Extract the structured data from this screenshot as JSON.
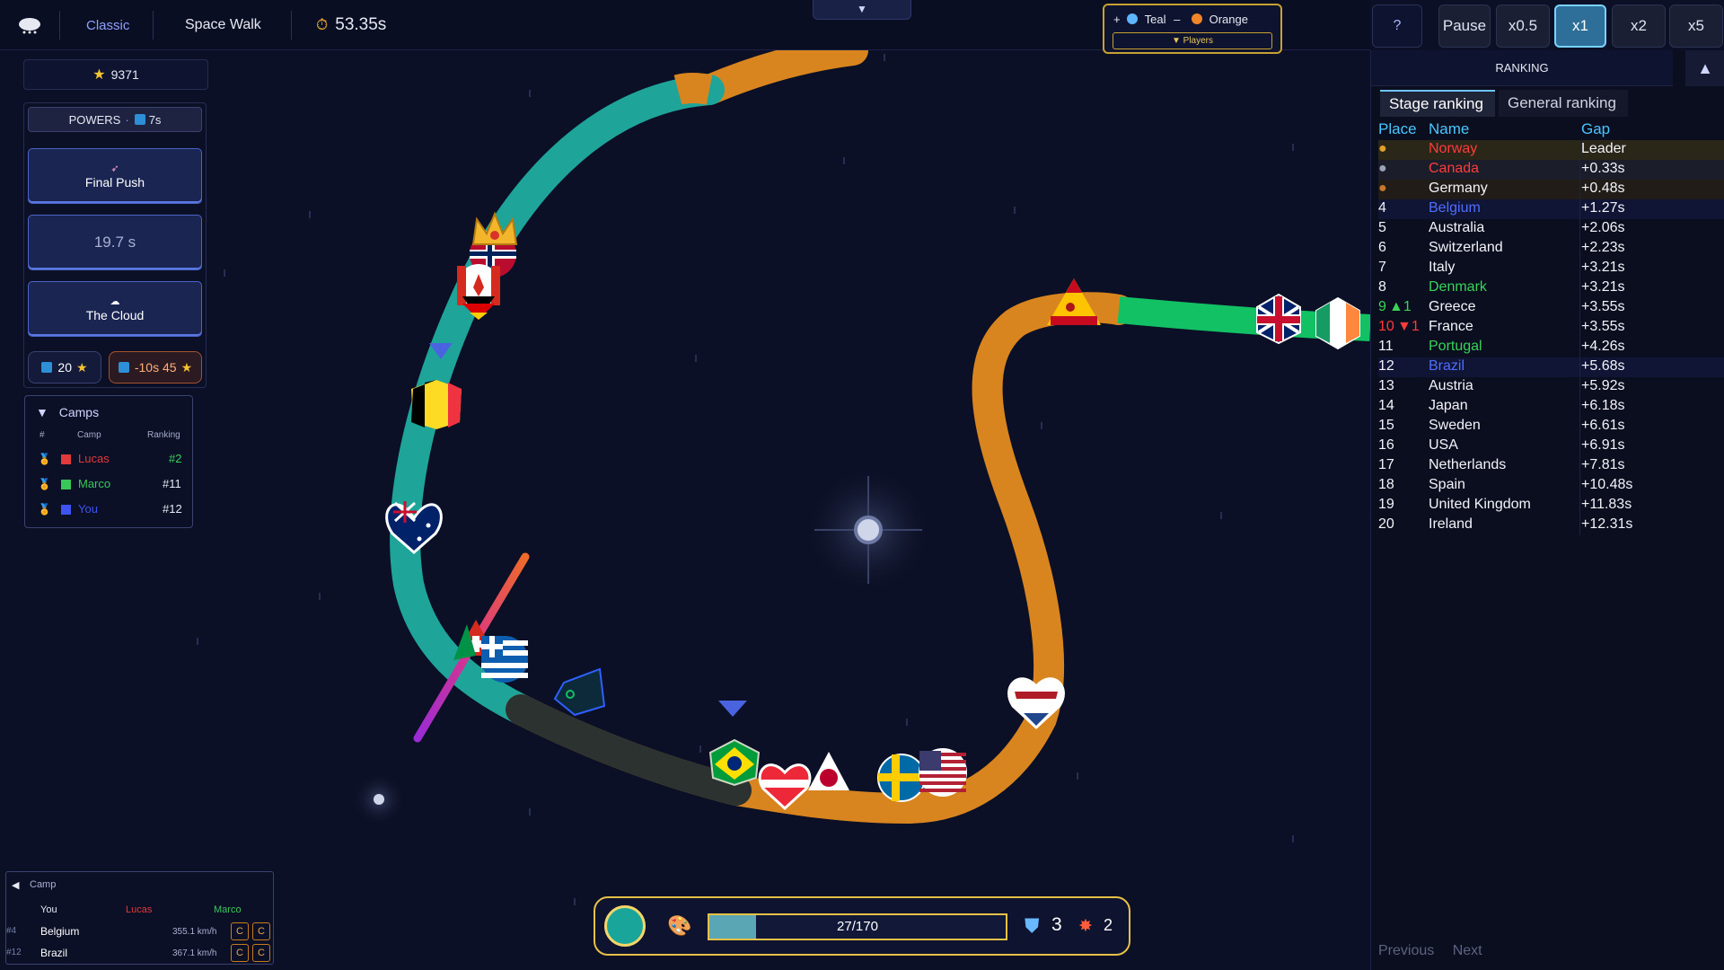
{
  "header": {
    "game_mode": "Classic",
    "level_name": "Space Walk",
    "timer": "53.35s",
    "collapse_glyph": "▼",
    "controls": {
      "help": "?",
      "pause": "Pause",
      "speeds": [
        "x0.5",
        "x1",
        "x2",
        "x5"
      ],
      "active_speed": "x1"
    }
  },
  "teams": {
    "plus": "+",
    "team_a": "Teal",
    "sep": "–",
    "team_b": "Orange",
    "players_label": "▼ Players",
    "team_a_color": "#5db6ff",
    "team_b_color": "#f0852a"
  },
  "stars": {
    "value": "9371"
  },
  "powers": {
    "header_label": "POWERS",
    "header_timer": "7s",
    "cards": [
      {
        "label": "Final Push",
        "icon": "rocket-icon"
      },
      {
        "label": "19.7 s",
        "icon": ""
      },
      {
        "label": "The Cloud",
        "icon": "cloud-icon"
      }
    ],
    "cost_a": "20",
    "cost_b": "-10s 45"
  },
  "camps": {
    "title": "Camps",
    "columns": [
      "#",
      "Camp",
      "Ranking"
    ],
    "rows": [
      {
        "name": "Lucas",
        "ranking": "#2",
        "color": "#e03a3a"
      },
      {
        "name": "Marco",
        "ranking": "#11",
        "color": "#39c75a"
      },
      {
        "name": "You",
        "ranking": "#12",
        "color": "#3d54f0"
      }
    ]
  },
  "camp_mini": {
    "title": "Camp",
    "col_you": "You",
    "col_lucas": "Lucas",
    "col_marco": "Marco",
    "rows": [
      {
        "place": "#4",
        "name": "Belgium",
        "speed": "355.1 km/h"
      },
      {
        "place": "#12",
        "name": "Brazil",
        "speed": "367.1 km/h"
      }
    ],
    "btn": "C"
  },
  "hud": {
    "progress_text": "27/170",
    "progress": 0.159,
    "shield_count": "3",
    "bolt_count": "2"
  },
  "ranking": {
    "title": "RANKING",
    "tabs": [
      "Stage ranking",
      "General ranking"
    ],
    "columns": [
      "Place",
      "Name",
      "Gap"
    ],
    "rows": [
      {
        "place": "",
        "medal": "gold",
        "name": "Norway",
        "gap": "Leader",
        "name_color": "#ff3b3b",
        "bg": "#2a2618"
      },
      {
        "place": "",
        "medal": "silver",
        "name": "Canada",
        "gap": "+0.33s",
        "name_color": "#ff3b3b",
        "bg": "#1b1d2a"
      },
      {
        "place": "",
        "medal": "bronze",
        "name": "Germany",
        "gap": "+0.48s",
        "name_color": "#f2f4fa",
        "bg": "#221c18"
      },
      {
        "place": "4",
        "name": "Belgium",
        "gap": "+1.27s",
        "name_color": "#4f6dff",
        "bg": "#101536"
      },
      {
        "place": "5",
        "name": "Australia",
        "gap": "+2.06s",
        "name_color": "#f2f4fa",
        "bg": ""
      },
      {
        "place": "6",
        "name": "Switzerland",
        "gap": "+2.23s",
        "name_color": "#f2f4fa",
        "bg": ""
      },
      {
        "place": "7",
        "name": "Italy",
        "gap": "+3.21s",
        "name_color": "#f2f4fa",
        "bg": ""
      },
      {
        "place": "8",
        "name": "Denmark",
        "gap": "+3.21s",
        "name_color": "#39d35a",
        "bg": ""
      },
      {
        "place": "9",
        "delta": "▲1",
        "delta_color": "#39d35a",
        "name": "Greece",
        "gap": "+3.55s",
        "name_color": "#f2f4fa",
        "bg": ""
      },
      {
        "place": "10",
        "delta": "▼1",
        "delta_color": "#ff3b3b",
        "name": "France",
        "gap": "+3.55s",
        "name_color": "#f2f4fa",
        "bg": ""
      },
      {
        "place": "11",
        "name": "Portugal",
        "gap": "+4.26s",
        "name_color": "#39d35a",
        "bg": ""
      },
      {
        "place": "12",
        "name": "Brazil",
        "gap": "+5.68s",
        "name_color": "#4f6dff",
        "bg": "#101536"
      },
      {
        "place": "13",
        "name": "Austria",
        "gap": "+5.92s",
        "name_color": "#f2f4fa",
        "bg": ""
      },
      {
        "place": "14",
        "name": "Japan",
        "gap": "+6.18s",
        "name_color": "#f2f4fa",
        "bg": ""
      },
      {
        "place": "15",
        "name": "Sweden",
        "gap": "+6.61s",
        "name_color": "#f2f4fa",
        "bg": ""
      },
      {
        "place": "16",
        "name": "USA",
        "gap": "+6.91s",
        "name_color": "#f2f4fa",
        "bg": ""
      },
      {
        "place": "17",
        "name": "Netherlands",
        "gap": "+7.81s",
        "name_color": "#f2f4fa",
        "bg": ""
      },
      {
        "place": "18",
        "name": "Spain",
        "gap": "+10.48s",
        "name_color": "#f2f4fa",
        "bg": ""
      },
      {
        "place": "19",
        "name": "United Kingdom",
        "gap": "+11.83s",
        "name_color": "#f2f4fa",
        "bg": ""
      },
      {
        "place": "20",
        "name": "Ireland",
        "gap": "+12.31s",
        "name_color": "#f2f4fa",
        "bg": ""
      }
    ],
    "prev": "Previous",
    "next": "Next"
  }
}
